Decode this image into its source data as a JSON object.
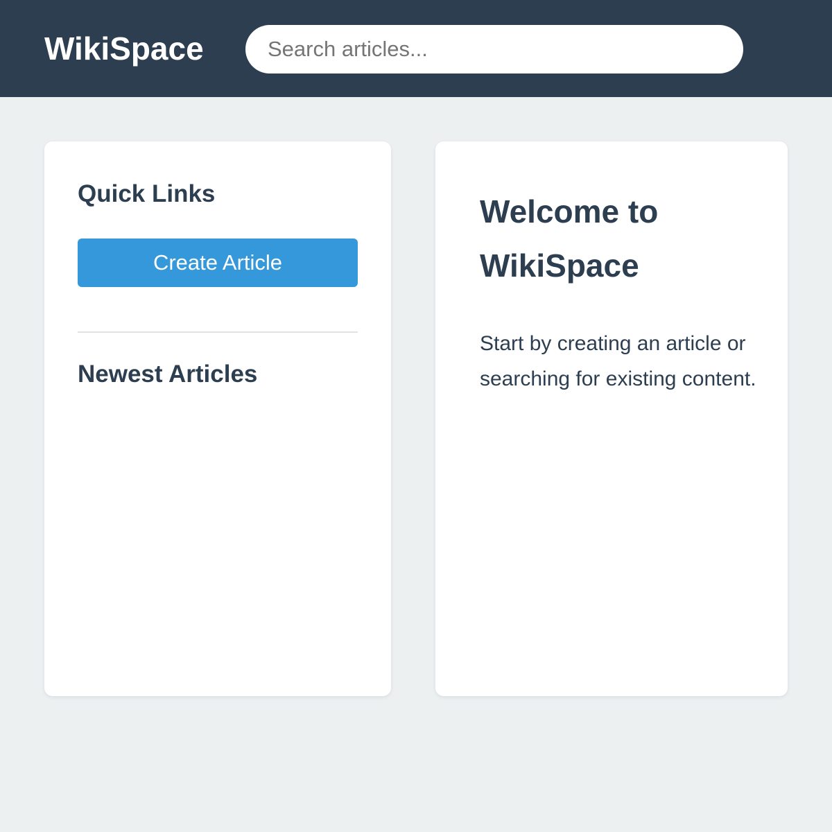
{
  "header": {
    "logo": "WikiSpace",
    "search_placeholder": "Search articles..."
  },
  "sidebar": {
    "quick_links_title": "Quick Links",
    "create_article_label": "Create Article",
    "newest_articles_title": "Newest Articles"
  },
  "main": {
    "welcome_title": "Welcome to WikiSpace",
    "welcome_text": "Start by creating an article or searching for existing content."
  },
  "colors": {
    "header_bg": "#2c3e50",
    "page_bg": "#ecf0f1",
    "accent": "#3498db",
    "text": "#2c3e50"
  }
}
